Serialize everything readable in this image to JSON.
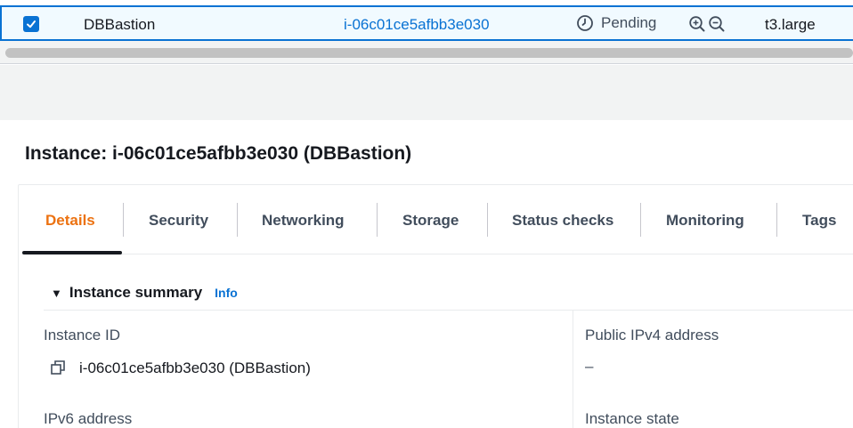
{
  "row": {
    "checked": true,
    "name": "DBBastion",
    "instance_id": "i-06c01ce5afbb3e030",
    "state": "Pending",
    "instance_type": "t3.large"
  },
  "panel": {
    "title": "Instance: i-06c01ce5afbb3e030 (DBBastion)",
    "tabs": [
      {
        "label": "Details",
        "active": true
      },
      {
        "label": "Security"
      },
      {
        "label": "Networking"
      },
      {
        "label": "Storage"
      },
      {
        "label": "Status checks"
      },
      {
        "label": "Monitoring"
      },
      {
        "label": "Tags"
      }
    ],
    "summary": {
      "title": "Instance summary",
      "info_link": "Info",
      "fields": {
        "instance_id_label": "Instance ID",
        "instance_id_value": "i-06c01ce5afbb3e030 (DBBastion)",
        "public_ipv4_label": "Public IPv4 address",
        "public_ipv4_value": "–",
        "ipv6_label": "IPv6 address",
        "instance_state_label": "Instance state"
      }
    }
  },
  "colors": {
    "accent_blue": "#0972d3",
    "active_tab_orange": "#ec7211",
    "band_gray": "#f2f3f3"
  },
  "icons": {
    "checkbox": "checkmark-icon",
    "state": "clock-icon",
    "zoom_in": "zoom-in-icon",
    "zoom_out": "zoom-out-icon",
    "copy": "copy-icon",
    "caret": "caret-down-icon"
  }
}
